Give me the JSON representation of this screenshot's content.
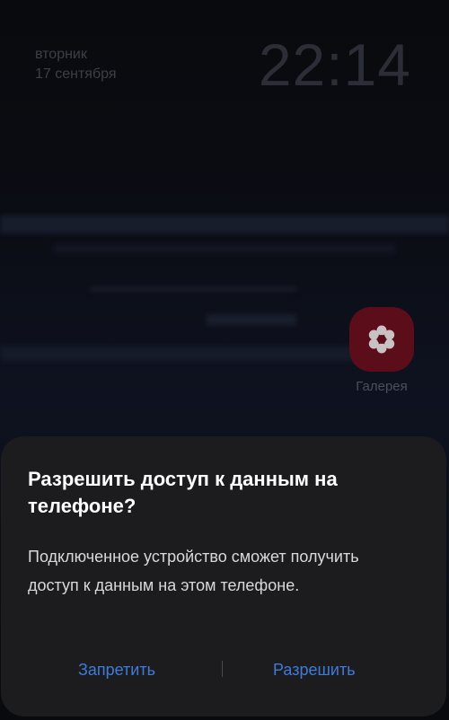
{
  "lockscreen": {
    "weekday": "вторник",
    "date": "17 сентября",
    "time": "22:14"
  },
  "apps": {
    "gallery": {
      "label": "Галерея",
      "icon": "flower-icon",
      "color": "#5b0e1a"
    }
  },
  "dialog": {
    "title": "Разрешить доступ к данным на телефоне?",
    "message": "Подключенное устройство сможет получить доступ к данным на этом телефоне.",
    "deny_label": "Запретить",
    "allow_label": "Разрешить",
    "accent_color": "#3f7bd9"
  }
}
